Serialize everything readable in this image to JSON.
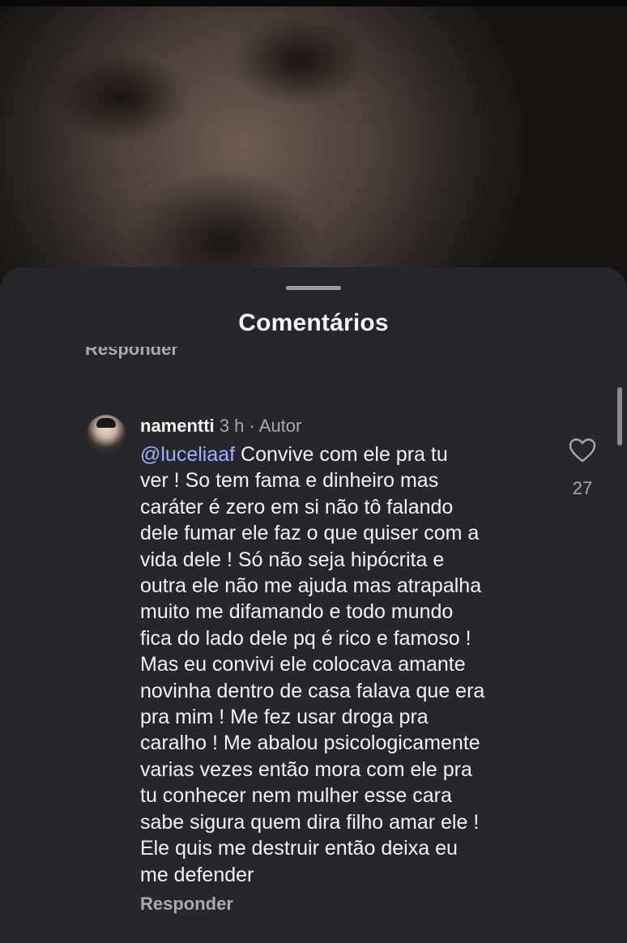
{
  "sheet": {
    "title": "Comentários",
    "previous_reply_label": "Responder"
  },
  "comment": {
    "username": "namentti",
    "time": "3 h",
    "separator": "·",
    "author_badge": "Autor",
    "mention": "@luceliaaf",
    "lines": [
      " Convive com ele pra tu",
      "ver ! So tem fama e dinheiro mas",
      "caráter é zero em si não tô falando",
      "dele fumar ele faz o que quiser com a",
      "vida dele ! Só não seja hipócrita e",
      "outra ele não me ajuda mas atrapalha",
      "muito me difamando e todo mundo",
      "fica do lado dele pq é rico e famoso !",
      "Mas eu convivi ele colocava amante",
      "novinha dentro de casa falava que era",
      "pra mim ! Me fez usar droga pra",
      "caralho ! Me abalou psicologicamente",
      "varias vezes então mora com ele pra",
      "tu conhecer nem mulher esse cara",
      "sabe sigura quem dira filho amar ele !",
      "Ele quis me destruir então deixa eu",
      "me defender"
    ],
    "likes": "27",
    "reply_label": "Responder"
  },
  "icons": {
    "like": "heart-icon"
  },
  "colors": {
    "sheet_bg": "#25272d",
    "mention": "#9ab1ff",
    "secondary_text": "#a7a9ae"
  }
}
